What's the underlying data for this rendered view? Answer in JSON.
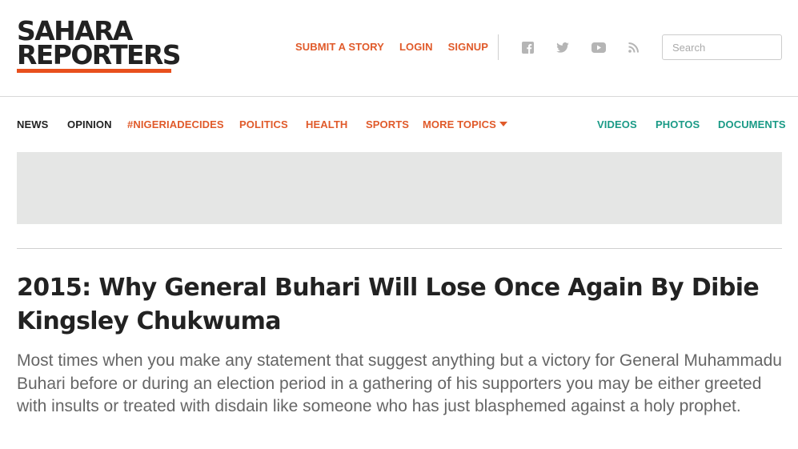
{
  "site": {
    "logo_line1": "SAHARA",
    "logo_line2": "REPORTERS",
    "brand_color": "#e8501d"
  },
  "header": {
    "links": [
      "SUBMIT A STORY",
      "LOGIN",
      "SIGNUP"
    ],
    "social_icons": [
      "facebook-icon",
      "twitter-icon",
      "youtube-icon",
      "rss-icon"
    ],
    "search_placeholder": "Search"
  },
  "nav": {
    "items": [
      {
        "label": "NEWS",
        "color": "#222222"
      },
      {
        "label": "OPINION",
        "color": "#222222"
      },
      {
        "label": "#NIGERIADECIDES",
        "color": "#e05a2a"
      },
      {
        "label": "POLITICS",
        "color": "#e05a2a"
      },
      {
        "label": "HEALTH",
        "color": "#e05a2a"
      },
      {
        "label": "SPORTS",
        "color": "#e05a2a"
      },
      {
        "label": "MORE TOPICS",
        "color": "#e05a2a",
        "has_dropdown": true
      }
    ],
    "media_items": [
      {
        "label": "VIDEOS",
        "color": "#1a9a86"
      },
      {
        "label": "PHOTOS",
        "color": "#1a9a86"
      },
      {
        "label": "DOCUMENTS",
        "color": "#1a9a86"
      }
    ]
  },
  "article": {
    "title": "2015: Why General Buhari Will Lose Once Again By Dibie Kingsley Chukwuma",
    "lede": "Most times when you make any statement that suggest anything but a victory for General Muhammadu Buhari before or during an election period in a gathering of his supporters you may be either greeted with insults or treated with disdain like someone who has just blasphemed against a holy prophet."
  }
}
